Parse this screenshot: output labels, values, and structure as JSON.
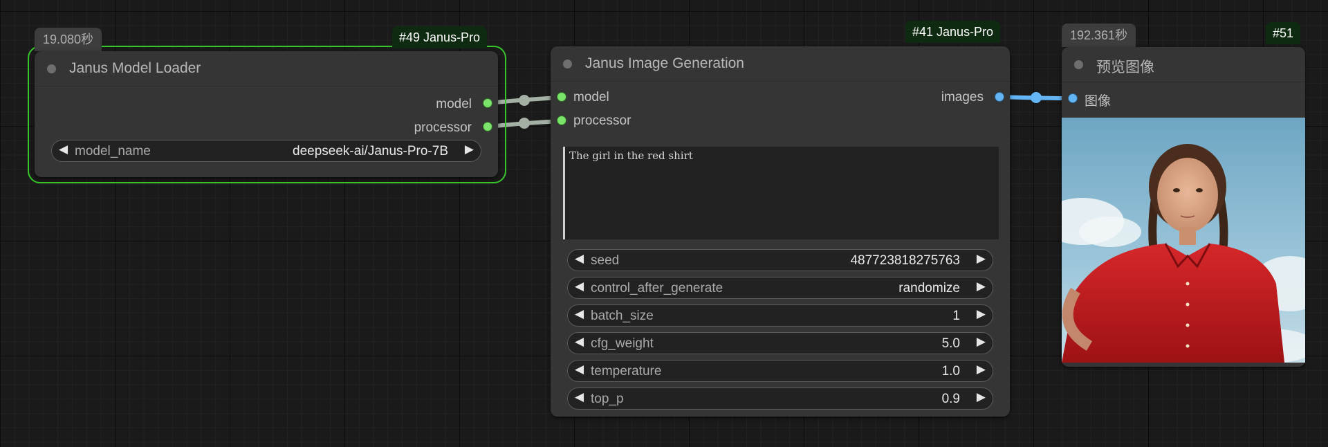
{
  "nodes": {
    "loader": {
      "id_badge": "#49 Janus-Pro",
      "time": "19.080秒",
      "title": "Janus Model Loader",
      "outputs": [
        "model",
        "processor"
      ],
      "widget": {
        "label": "model_name",
        "value": "deepseek-ai/Janus-Pro-7B"
      }
    },
    "generation": {
      "id_badge": "#41 Janus-Pro",
      "title": "Janus Image Generation",
      "inputs": [
        "model",
        "processor"
      ],
      "output": "images",
      "prompt": "The girl in the red shirt",
      "widgets": [
        {
          "label": "seed",
          "value": "487723818275763"
        },
        {
          "label": "control_after_generate",
          "value": "randomize"
        },
        {
          "label": "batch_size",
          "value": "1"
        },
        {
          "label": "cfg_weight",
          "value": "5.0"
        },
        {
          "label": "temperature",
          "value": "1.0"
        },
        {
          "label": "top_p",
          "value": "0.9"
        }
      ]
    },
    "preview": {
      "id_badge": "#51",
      "time": "192.361秒",
      "title": "预览图像",
      "input": "图像"
    }
  },
  "arrows": {
    "left": "◀",
    "right": "▶"
  },
  "colors": {
    "canvas_bg": "#1a1a1a",
    "node_bg": "#353535",
    "selected_outline": "#36c62b",
    "model_link": "#a3b0a3",
    "image_link": "#64b5f6",
    "badge_bg": "#0e2a10"
  }
}
